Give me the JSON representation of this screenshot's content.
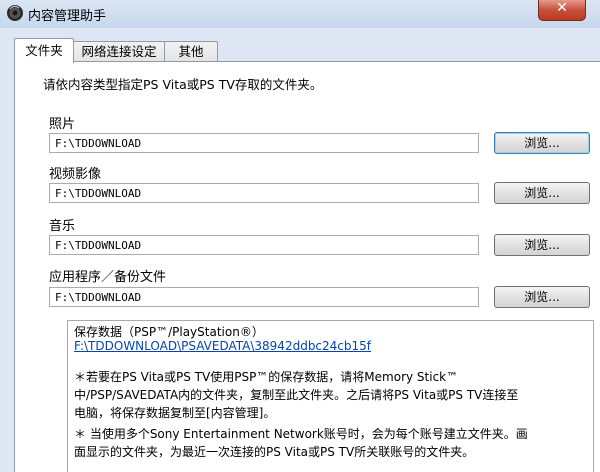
{
  "window": {
    "title": "内容管理助手",
    "close_glyph": "✕"
  },
  "tabs": [
    {
      "label": "文件夹",
      "selected": true
    },
    {
      "label": "网络连接设定",
      "selected": false
    },
    {
      "label": "其他",
      "selected": false
    }
  ],
  "instruction": "请依内容类型指定PS  Vita或PS  TV存取的文件夹。",
  "folders": [
    {
      "label": "照片",
      "path": "F:\\TDDOWNLOAD",
      "browse": "浏览..."
    },
    {
      "label": "视频影像",
      "path": "F:\\TDDOWNLOAD",
      "browse": "浏览..."
    },
    {
      "label": "音乐",
      "path": "F:\\TDDOWNLOAD",
      "browse": "浏览..."
    },
    {
      "label": "应用程序／备份文件",
      "path": "F:\\TDDOWNLOAD",
      "browse": "浏览..."
    }
  ],
  "savedata": {
    "heading": "保存数据（PSP™/PlayStation®）",
    "link": "F:\\TDDOWNLOAD\\PSAVEDATA\\38942ddbc24cb15f",
    "notes": [
      "＊若要在PS  Vita或PS  TV使用PSP™的保存数据，请将Memory Stick™",
      "中/PSP/SAVEDATA内的文件夹，复制至此文件夹。之后请将PS  Vita或PS  TV连接至",
      "电脑，将保存数据复制至[内容管理]。",
      "＊ 当使用多个Sony Entertainment Network账号时，会为每个账号建立文件夹。画",
      "面显示的文件夹，为最近一次连接的PS  Vita或PS  TV所关联账号的文件夹。"
    ]
  }
}
